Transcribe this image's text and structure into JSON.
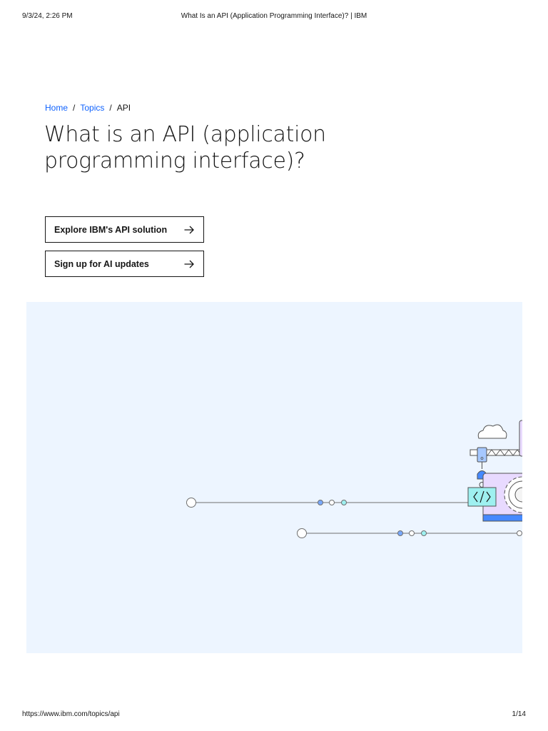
{
  "print_header": {
    "date": "9/3/24, 2:26 PM",
    "title": "What Is an API (Application Programming Interface)? | IBM"
  },
  "breadcrumb": {
    "items": [
      {
        "label": "Home"
      },
      {
        "label": "Topics"
      }
    ],
    "separator": "/",
    "current": "API"
  },
  "page_title": "What is an API (application programming interface)?",
  "buttons": {
    "explore_label": "Explore IBM's API solution",
    "signup_label": "Sign up for AI updates"
  },
  "print_footer": {
    "url": "https://www.ibm.com/topics/api",
    "page": "1/14"
  },
  "icons": {
    "button_arrow": "arrow-right-icon",
    "code": "code-brackets-icon",
    "cloud": "cloud-icon",
    "gear": "gear-icon",
    "crane": "crane-icon"
  },
  "colors": {
    "link": "#0f62fe",
    "hero_background": "#edf5ff",
    "text": "#161616",
    "accent_teal": "#9ef0f0",
    "accent_blue": "#4589ff",
    "accent_purple": "#e8daff"
  }
}
